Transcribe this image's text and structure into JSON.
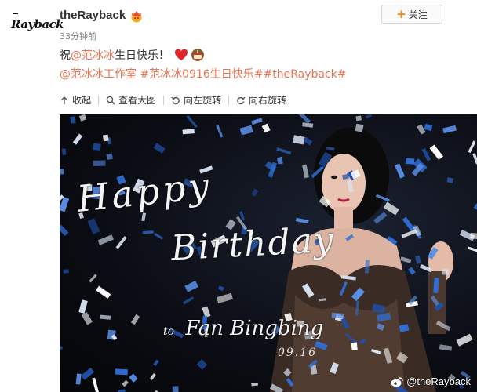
{
  "account": {
    "logo_text": "Rayback",
    "name": "theRayback",
    "time": "33分钟前",
    "follow_label": "关注"
  },
  "post": {
    "prefix": "祝",
    "mention": "@范冰冰",
    "suffix": " 生日快乐！",
    "tags": "@范冰冰工作室 #范冰冰0916生日快乐##theRayback#"
  },
  "toolbar": {
    "collapse": "收起",
    "view_large": "查看大图",
    "rotate_left": "向左旋转",
    "rotate_right": "向右旋转"
  },
  "image": {
    "happy": "Happy",
    "birthday": "Birthday",
    "to": "to",
    "name": "Fan Bingbing",
    "date": "09.16",
    "watermark": "@theRayback"
  },
  "colors": {
    "link": "#eb7350",
    "follow_plus": "#ff8200",
    "confetti_blue": "#2f6fd8",
    "confetti_light": "#dbe6f5"
  }
}
